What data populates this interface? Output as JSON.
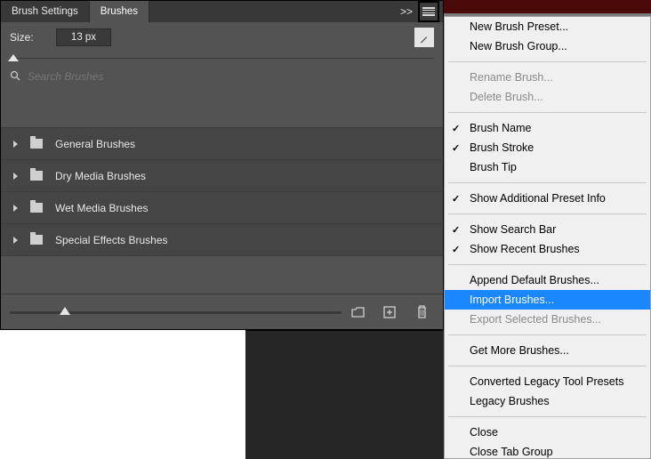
{
  "tabs": {
    "settings": "Brush Settings",
    "brushes": "Brushes",
    "active": "brushes"
  },
  "size": {
    "label": "Size:",
    "value": "13 px"
  },
  "search": {
    "placeholder": "Search Brushes"
  },
  "brush_folders": [
    {
      "label": "General Brushes"
    },
    {
      "label": "Dry Media Brushes"
    },
    {
      "label": "Wet Media Brushes"
    },
    {
      "label": "Special Effects Brushes"
    }
  ],
  "flyout_menu": [
    {
      "type": "item",
      "label": "New Brush Preset...",
      "enabled": true
    },
    {
      "type": "item",
      "label": "New Brush Group...",
      "enabled": true
    },
    {
      "type": "sep"
    },
    {
      "type": "item",
      "label": "Rename Brush...",
      "enabled": false
    },
    {
      "type": "item",
      "label": "Delete Brush...",
      "enabled": false
    },
    {
      "type": "sep"
    },
    {
      "type": "item",
      "label": "Brush Name",
      "enabled": true,
      "checked": true
    },
    {
      "type": "item",
      "label": "Brush Stroke",
      "enabled": true,
      "checked": true
    },
    {
      "type": "item",
      "label": "Brush Tip",
      "enabled": true
    },
    {
      "type": "sep"
    },
    {
      "type": "item",
      "label": "Show Additional Preset Info",
      "enabled": true,
      "checked": true
    },
    {
      "type": "sep"
    },
    {
      "type": "item",
      "label": "Show Search Bar",
      "enabled": true,
      "checked": true
    },
    {
      "type": "item",
      "label": "Show Recent Brushes",
      "enabled": true,
      "checked": true
    },
    {
      "type": "sep"
    },
    {
      "type": "item",
      "label": "Append Default Brushes...",
      "enabled": true
    },
    {
      "type": "item",
      "label": "Import Brushes...",
      "enabled": true,
      "highlight": true
    },
    {
      "type": "item",
      "label": "Export Selected Brushes...",
      "enabled": false
    },
    {
      "type": "sep"
    },
    {
      "type": "item",
      "label": "Get More Brushes...",
      "enabled": true
    },
    {
      "type": "sep"
    },
    {
      "type": "item",
      "label": "Converted Legacy Tool Presets",
      "enabled": true
    },
    {
      "type": "item",
      "label": "Legacy Brushes",
      "enabled": true
    },
    {
      "type": "sep"
    },
    {
      "type": "item",
      "label": "Close",
      "enabled": true
    },
    {
      "type": "item",
      "label": "Close Tab Group",
      "enabled": true
    }
  ]
}
